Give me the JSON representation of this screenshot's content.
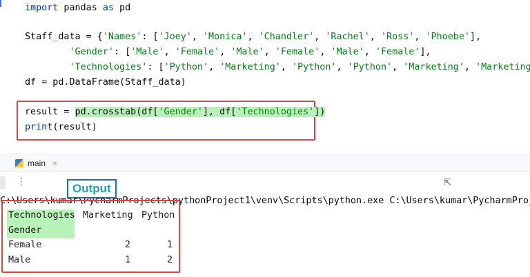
{
  "code": {
    "line1": {
      "kw_import": "import",
      "mod": " pandas ",
      "kw_as": "as",
      "alias": " pd"
    },
    "line3": {
      "prefix": "Staff_data = {",
      "k1": "'Names'",
      "mid": ": [",
      "v1": "'Joey'",
      "c1": ", ",
      "v2": "'Monica'",
      "c2": ", ",
      "v3": "'Chandler'",
      "c3": ", ",
      "v4": "'Rachel'",
      "c4": ", ",
      "v5": "'Ross'",
      "c5": ", ",
      "v6": "'Phoebe'",
      "end": "],"
    },
    "line4": {
      "indent": "        ",
      "k2": "'Gender'",
      "mid": ": [",
      "v1": "'Male'",
      "c1": ", ",
      "v2": "'Female'",
      "c2": ", ",
      "v3": "'Male'",
      "c3": ", ",
      "v4": "'Female'",
      "c4": ", ",
      "v5": "'Male'",
      "c5": ", ",
      "v6": "'Female'",
      "end": "],"
    },
    "line5": {
      "indent": "        ",
      "k3": "'Technologies'",
      "mid": ": [",
      "v1": "'Python'",
      "c1": ", ",
      "v2": "'Marketing'",
      "c2": ", ",
      "v3": "'Python'",
      "c3": ", ",
      "v4": "'Python'",
      "c4": ", ",
      "v5": "'Marketing'",
      "c5": ", ",
      "v6": "'Marketing'",
      "end": "]}"
    },
    "line6": "df = pd.DataFrame(Staff_data)",
    "line8": {
      "prefix": "result = ",
      "call_a": "pd.crosstab(df[",
      "s1": "'Gender'",
      "call_b": "], df[",
      "s2": "'Technologies'",
      "call_c": "])"
    },
    "line9": {
      "fn": "print",
      "rest": "(result)"
    }
  },
  "run_tab": {
    "label": "main",
    "close": "×"
  },
  "toolbar": {
    "more": "⋮",
    "cursor": "⇱"
  },
  "output_label": "Output",
  "console": {
    "command": "C:\\Users\\kumar\\PycharmProjects\\pythonProject1\\venv\\Scripts\\python.exe C:\\Users\\kumar\\PycharmProject",
    "table": {
      "col_header": "Technologies",
      "columns": [
        "Marketing",
        "Python"
      ],
      "row_header": "Gender",
      "rows": [
        {
          "label": "Female",
          "values": [
            "2",
            "1"
          ]
        },
        {
          "label": "Male",
          "values": [
            "1",
            "2"
          ]
        }
      ]
    }
  }
}
